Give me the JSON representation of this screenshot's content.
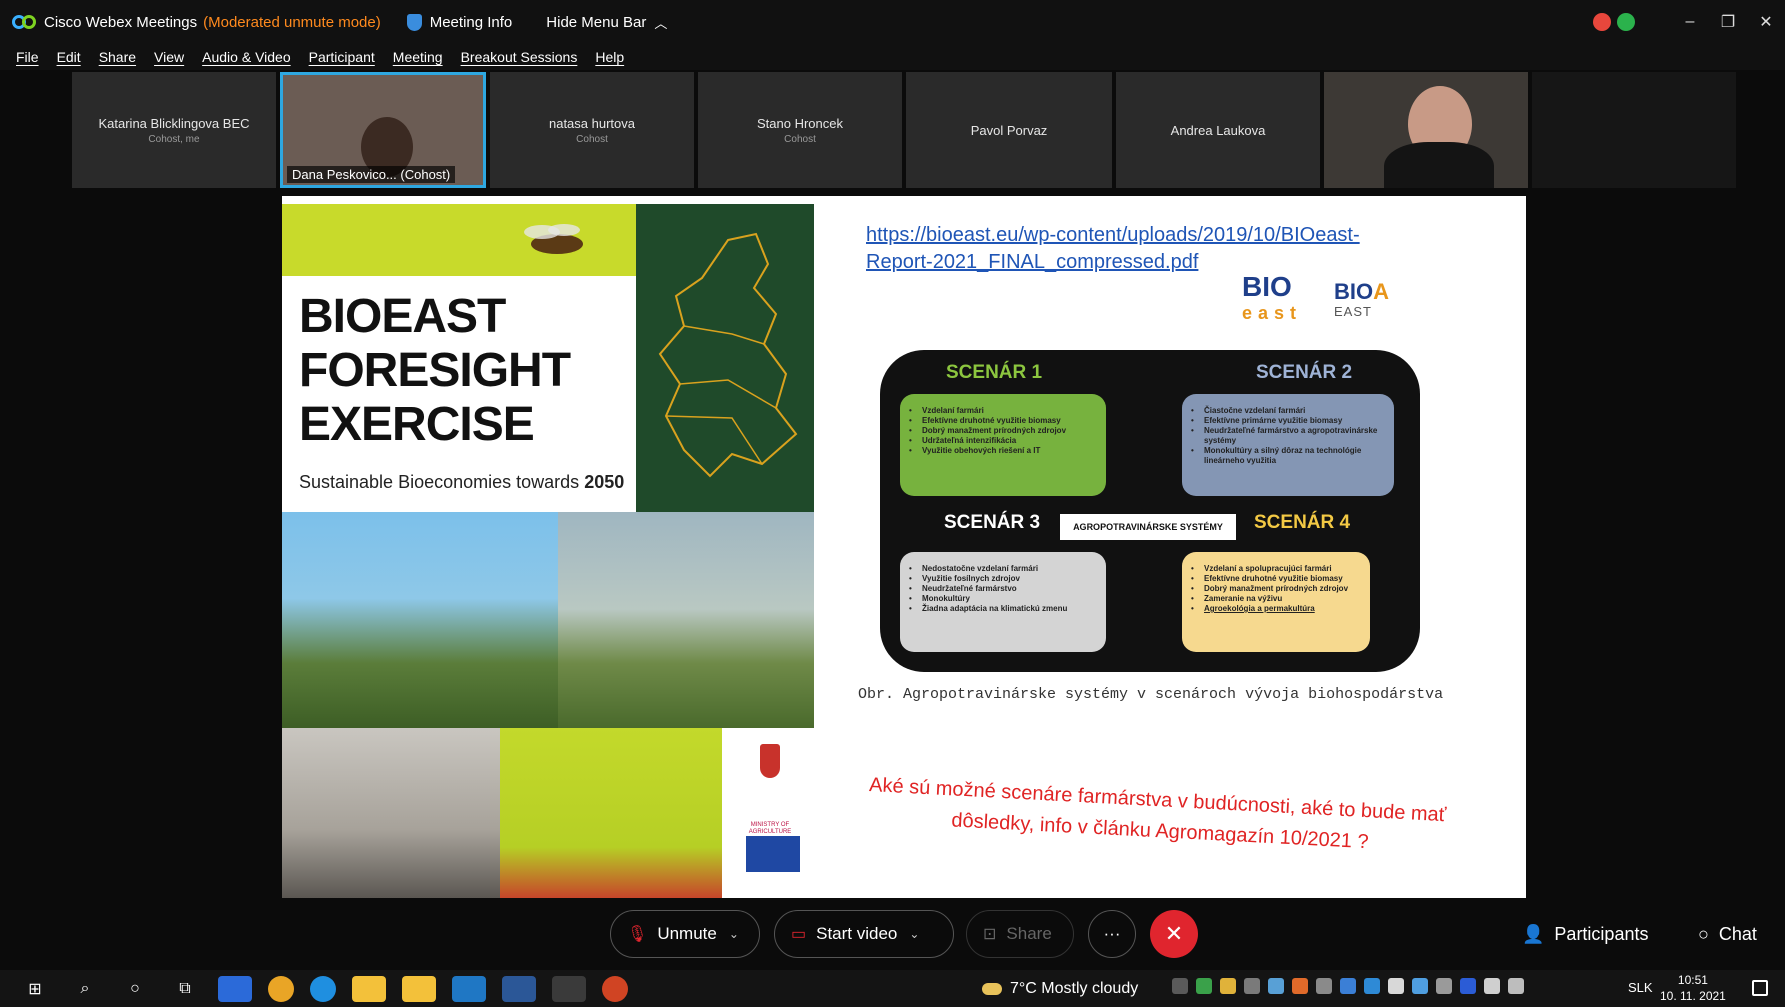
{
  "window": {
    "app_title": "Cisco Webex Meetings",
    "mode": "(Moderated unmute mode)",
    "meeting_info": "Meeting Info",
    "hide_menu": "Hide Menu Bar"
  },
  "menu": [
    "File",
    "Edit",
    "Share",
    "View",
    "Audio & Video",
    "Participant",
    "Meeting",
    "Breakout Sessions",
    "Help"
  ],
  "participants": [
    {
      "name": "Katarina Blicklingova BEC",
      "role": "Cohost, me"
    },
    {
      "name": "Dana Peskovico... (Cohost)",
      "role": ""
    },
    {
      "name": "natasa hurtova",
      "role": "Cohost"
    },
    {
      "name": "Stano Hroncek",
      "role": "Cohost"
    },
    {
      "name": "Pavol Porvaz",
      "role": ""
    },
    {
      "name": "Andrea Laukova",
      "role": ""
    }
  ],
  "slide": {
    "cover": {
      "title_lines": [
        "BIOEAST",
        "FORESIGHT",
        "EXERCISE"
      ],
      "subtitle": "Sustainable Bioeconomies towards",
      "subtitle_year": "2050",
      "ministry": "MINISTRY OF AGRICULTURE"
    },
    "link_line1": "https://bioeast.eu/wp-content/uploads/2019/10/BIOeast-",
    "link_line2": "Report-2021_FINAL_compressed.pdf",
    "logo1_main": "BIO",
    "logo1_sub": "east",
    "logo2_main": "BIO",
    "logo2_accent": "A",
    "logo2_sub": "EAST",
    "scenarios": {
      "s1_title": "SCENÁR 1",
      "s2_title": "SCENÁR 2",
      "s3_title": "SCENÁR 3",
      "s4_title": "SCENÁR 4",
      "center": "AGROPOTRAVINÁRSKE SYSTÉMY",
      "s1_items": [
        "Vzdelaní farmári",
        "Efektívne druhotné využitie biomasy",
        "Dobrý manažment prírodných zdrojov",
        "Udržateľná intenzifikácia",
        "Využitie obehových riešení a IT"
      ],
      "s2_items": [
        "Čiastočne vzdelaní farmári",
        "Efektívne primárne využitie biomasy",
        "Neudržateľné farmárstvo a agropotravinárske systémy",
        "Monokultúry a silný dôraz na technológie lineárneho využitia"
      ],
      "s3_items": [
        "Nedostatočne vzdelaní farmári",
        "Využitie fosílnych zdrojov",
        "Neudržateľné farmárstvo",
        "Monokultúry",
        "Žiadna adaptácia na klimatickú zmenu"
      ],
      "s4_items": [
        "Vzdelaní a spolupracujúci farmári",
        "Efektívne druhotné využitie biomasy",
        "Dobrý manažment prírodných zdrojov",
        "Zameranie na výživu",
        "Agroekológia a permakultúra"
      ]
    },
    "caption": "Obr. Agropotravinárske systémy v scenároch vývoja biohospodárstva",
    "question_line1": "Aké sú možné scenáre farmárstva v budúcnosti, aké to bude mať",
    "question_line2": "dôsledky, info v článku Agromagazín 10/2021 ?"
  },
  "controls": {
    "unmute": "Unmute",
    "start_video": "Start video",
    "share": "Share",
    "more": "···",
    "participants": "Participants",
    "chat": "Chat"
  },
  "taskbar": {
    "weather": "7°C  Mostly cloudy",
    "lang": "SLK",
    "time": "10:51",
    "date": "10. 11. 2021"
  },
  "colors": {
    "accent_blue": "#2ea7e0",
    "end_red": "#e0252e",
    "mode_orange": "#ff8a1e",
    "s1": "#77b23e",
    "s2": "#8496b4",
    "s3": "#d4d4d4",
    "s4": "#f6d98f"
  }
}
